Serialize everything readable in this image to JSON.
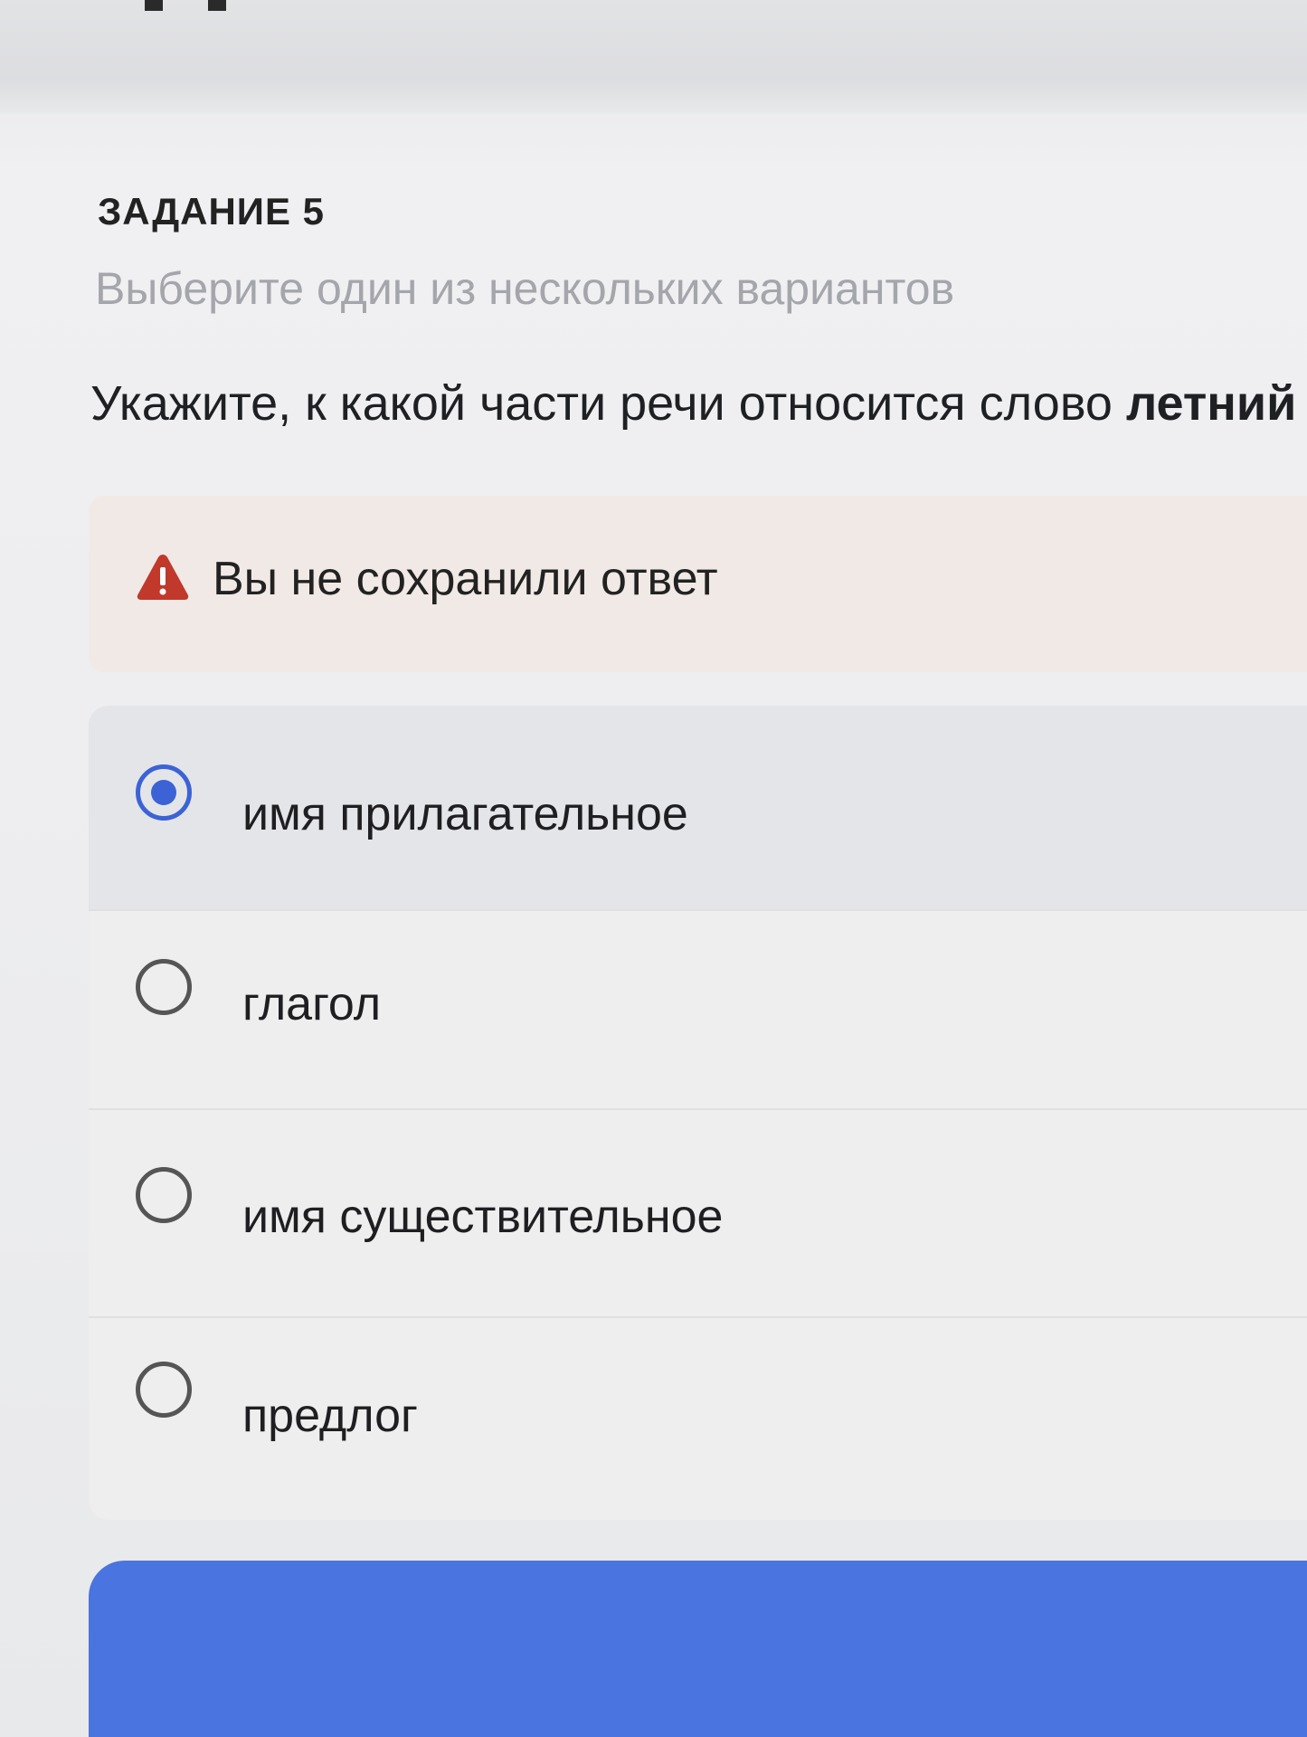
{
  "task": {
    "label": "ЗАДАНИЕ 5",
    "hint": "Выберите один из нескольких вариантов",
    "question_prefix": "Укажите, к какой части речи относится слово ",
    "question_word": "летний"
  },
  "warning": {
    "icon": "warning-triangle-icon",
    "text": "Вы не сохранили ответ",
    "color": "#c0392b"
  },
  "options": [
    {
      "label": "имя прилагательное",
      "selected": true
    },
    {
      "label": "глагол",
      "selected": false
    },
    {
      "label": "имя существительное",
      "selected": false
    },
    {
      "label": "предлог",
      "selected": false
    }
  ],
  "colors": {
    "accent": "#3b63d6",
    "button": "#4a74df",
    "warning_bg": "#f1e9e5"
  }
}
